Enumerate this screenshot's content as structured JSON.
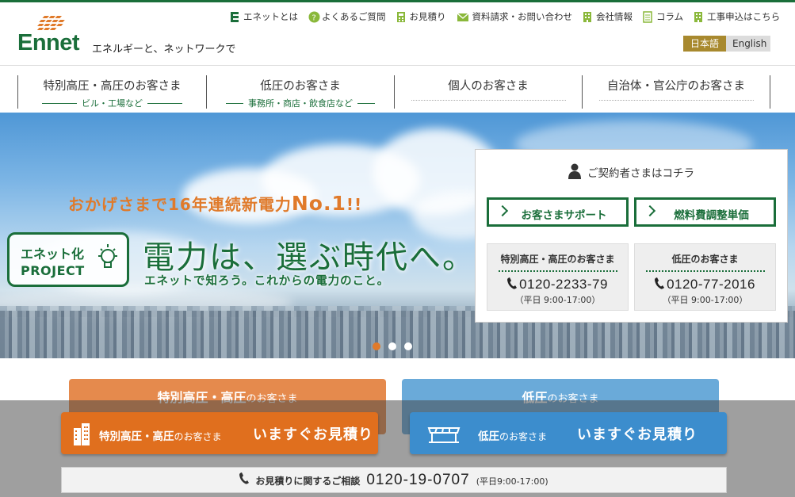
{
  "brand": {
    "logo_text": "Ennet",
    "tagline": "エネルギーと、ネットワークで",
    "accent_color": "#1a6e3a",
    "orange_color": "#e07a2a",
    "blue_color": "#3c8dcd"
  },
  "util_nav": [
    {
      "label": "エネットとは",
      "icon": "e-logo-icon"
    },
    {
      "label": "よくあるご質問",
      "icon": "question-icon"
    },
    {
      "label": "お見積り",
      "icon": "calculator-icon"
    },
    {
      "label": "資料請求・お問い合わせ",
      "icon": "mail-icon"
    },
    {
      "label": "会社情報",
      "icon": "building-icon"
    },
    {
      "label": "コラム",
      "icon": "document-icon"
    },
    {
      "label": "工事申込はこちら",
      "icon": "building-icon"
    }
  ],
  "language": {
    "ja": "日本語",
    "en": "English",
    "selected": "日本語"
  },
  "main_nav": [
    {
      "title": "特別高圧・高圧のお客さま",
      "sub": "ビル・工場など"
    },
    {
      "title": "低圧のお客さま",
      "sub": "事務所・商店・飲食店など"
    },
    {
      "title": "個人のお客さま",
      "sub": ""
    },
    {
      "title": "自治体・官公庁のお客さま",
      "sub": ""
    }
  ],
  "hero": {
    "catch_prefix": "おかげさまで16年連続新電力",
    "catch_big": "No.1",
    "catch_suffix": "!!",
    "project_line1": "エネット化",
    "project_line2": "PROJECT",
    "headline": "電力は、選ぶ時代へ。",
    "subline": "エネットで知ろう。これからの電力のこと。",
    "slide_count": 3,
    "active_slide": 1
  },
  "contract_panel": {
    "title": "ご契約者さまはコチラ",
    "support_button": "お客さまサポート",
    "fuel_button": "燃料費調整単価",
    "cards": [
      {
        "title": "特別高圧・高圧のお客さま",
        "tel": "0120-2233-79",
        "hours": "（平日 9:00-17:00）"
      },
      {
        "title": "低圧のお客さま",
        "tel": "0120-77-2016",
        "hours": "（平日 9:00-17:00）"
      }
    ]
  },
  "segments": [
    {
      "strong": "特別高圧・高圧",
      "rest": "のお客さま"
    },
    {
      "strong": "低圧",
      "rest": "のお客さま"
    }
  ],
  "ctas": [
    {
      "strong": "特別高圧・高圧",
      "rest": "のお客さま",
      "action": "いますぐお見積り"
    },
    {
      "strong": "低圧",
      "rest": "のお客さま",
      "action": "いますぐお見積り"
    }
  ],
  "consult": {
    "label": "お見積りに関するご相談",
    "tel": "0120-19-0707",
    "hours": "(平日9:00-17:00)"
  }
}
